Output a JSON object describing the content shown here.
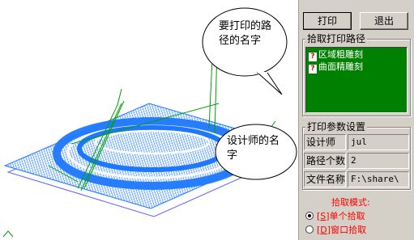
{
  "toolbar": {
    "print_label": "打印",
    "exit_label": "退出"
  },
  "pick_group": {
    "title": "拾取打印路径",
    "items": [
      {
        "icon": "question-icon",
        "label": "区域粗雕刻"
      },
      {
        "icon": "question-icon",
        "label": "曲面精雕刻"
      }
    ]
  },
  "params_group": {
    "title": "打印参数设置",
    "designer_label": "设计师",
    "designer_value": "jul",
    "path_count_label": "路径个数",
    "path_count_value": "2",
    "file_name_label": "文件名称",
    "file_name_value": "F:\\share\\"
  },
  "pick_mode": {
    "title": "拾取模式:",
    "options": [
      {
        "prefix": "[",
        "accel": "S",
        "suffix": "]单个拾取",
        "selected": true
      },
      {
        "prefix": "[",
        "accel": "D",
        "suffix": "]窗口拾取",
        "selected": false
      }
    ]
  },
  "callouts": {
    "path_name": [
      "要打印的路",
      "径的名字"
    ],
    "designer_name": [
      "设计师的名",
      "字"
    ]
  },
  "colors": {
    "toolpath": "#1e78ff",
    "list_bg": "#008000",
    "mode_text": "#ff0000",
    "panel_bg": "#d4d0c8"
  }
}
